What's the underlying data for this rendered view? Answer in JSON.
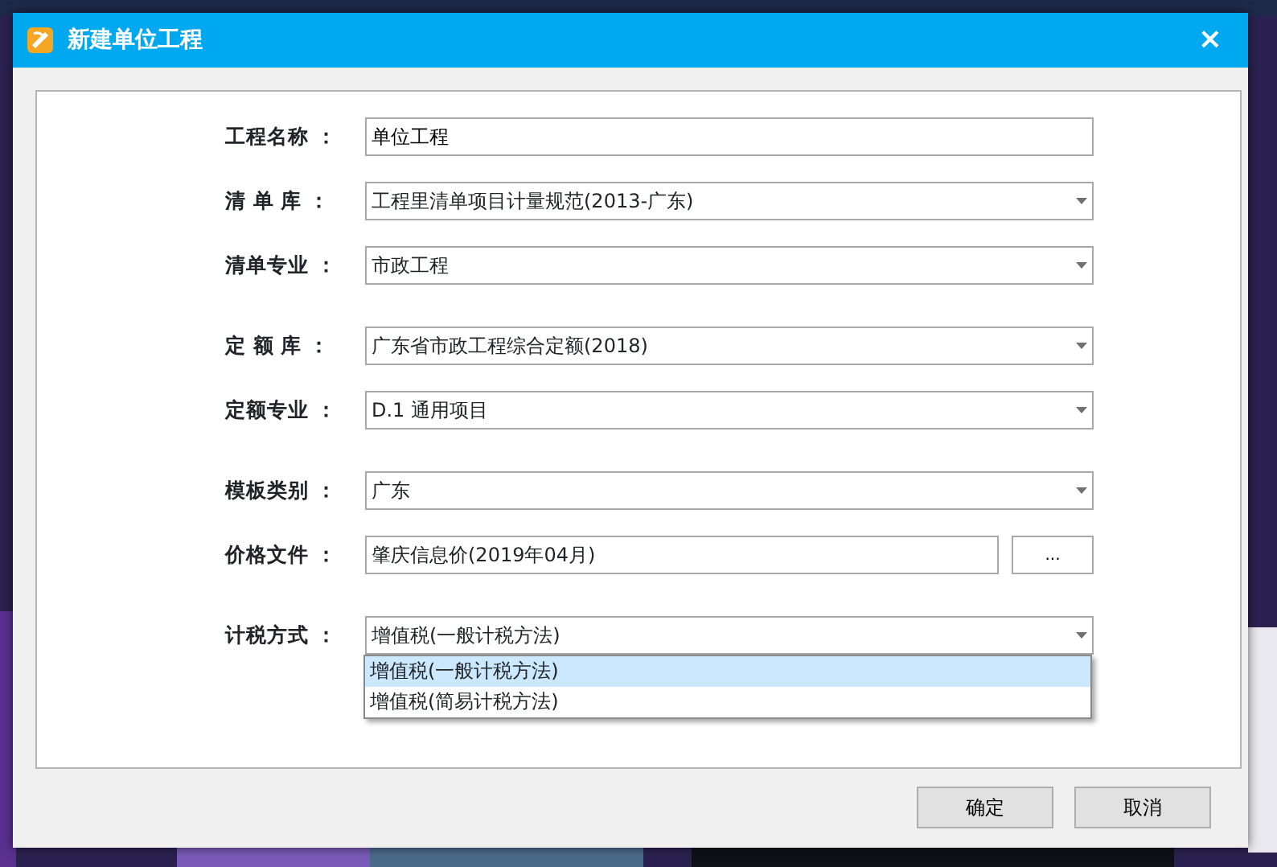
{
  "dialog": {
    "title": "新建单位工程",
    "close": "×"
  },
  "groups": [
    [
      {
        "kind": "text",
        "label": "工程名称 ：",
        "value": "单位工程"
      },
      {
        "kind": "select",
        "label": "清 单 库 ：",
        "value": "工程里清单项目计量规范(2013-广东)"
      },
      {
        "kind": "select",
        "label": "清单专业 ：",
        "value": "市政工程"
      }
    ],
    [
      {
        "kind": "select",
        "label": "定 额 库 ：",
        "value": "广东省市政工程综合定额(2018)"
      },
      {
        "kind": "select",
        "label": "定额专业 ：",
        "value": "D.1 通用项目"
      }
    ],
    [
      {
        "kind": "select",
        "label": "模板类别 ：",
        "value": "广东"
      },
      {
        "kind": "browse",
        "label": "价格文件 ：",
        "value": "肇庆信息价(2019年04月)",
        "button": "..."
      }
    ],
    [
      {
        "kind": "select",
        "label": "计税方式 ：",
        "value": "增值税(一般计税方法)",
        "expanded": true,
        "options": [
          {
            "text": "增值税(一般计税方法)",
            "selected": true
          },
          {
            "text": "增值税(简易计税方法)",
            "selected": false
          }
        ]
      }
    ]
  ],
  "buttons": [
    "确定",
    "取消"
  ]
}
